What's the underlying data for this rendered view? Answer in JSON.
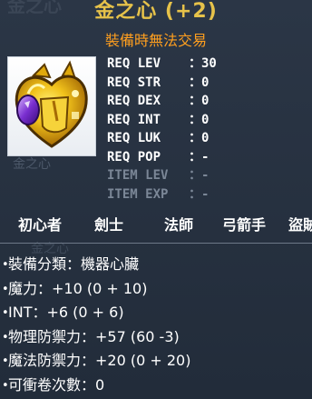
{
  "header": {
    "ghost_title": "金之心",
    "item_name": "金之心 (+2)",
    "trade_restriction": "裝備時無法交易",
    "title_color": "#e6c24a",
    "subtitle_color": "#ff9f1f"
  },
  "item_icon": {
    "icon": "golden-heart-icon",
    "caption": "金之心"
  },
  "requirements": [
    {
      "label": "REQ LEV",
      "value": "30"
    },
    {
      "label": "REQ STR",
      "value": "0"
    },
    {
      "label": "REQ DEX",
      "value": "0"
    },
    {
      "label": "REQ INT",
      "value": "0"
    },
    {
      "label": "REQ LUK",
      "value": "0"
    },
    {
      "label": "REQ POP",
      "value": "-"
    },
    {
      "label": "ITEM LEV",
      "value": "-"
    },
    {
      "label": "ITEM EXP",
      "value": "-"
    }
  ],
  "separator": "：",
  "jobs": [
    "初心者",
    "劍士",
    "法師",
    "弓箭手",
    "盜賊"
  ],
  "ghost_caption": "金之心",
  "properties": [
    {
      "text": "裝備分類：機器心臟"
    },
    {
      "text": "魔力：+10 (0 + 10)"
    },
    {
      "text": "INT：+6 (0 + 6)"
    },
    {
      "text": "物理防禦力：+57 (60 -3)"
    },
    {
      "text": "魔法防禦力：+20 (0 + 20)"
    },
    {
      "text": "可衝卷次數：0"
    }
  ],
  "bullet": "•"
}
